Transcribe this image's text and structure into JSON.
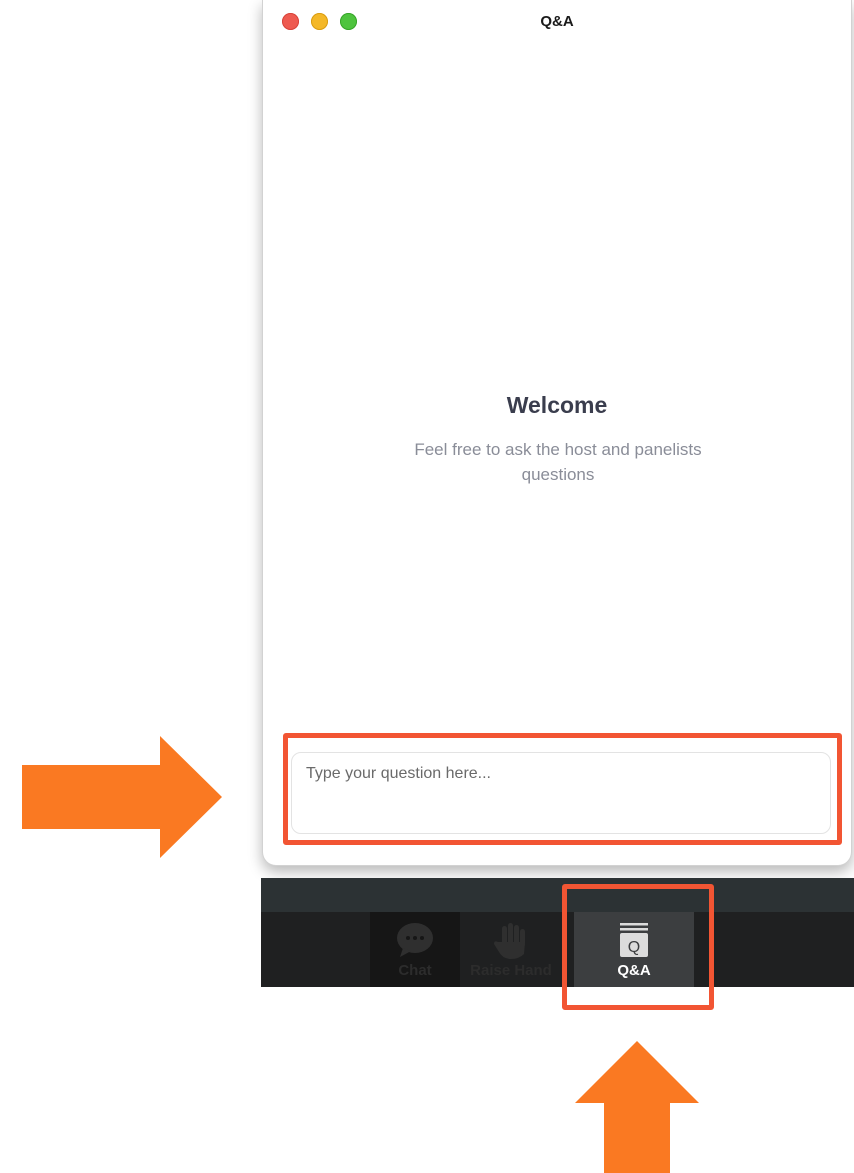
{
  "window": {
    "title": "Q&A"
  },
  "welcome": {
    "title": "Welcome",
    "text": "Feel free to ask the host and panelists questions"
  },
  "question_input": {
    "placeholder": "Type your question here...",
    "value": ""
  },
  "toolbar": {
    "items": [
      {
        "label": "Chat",
        "icon": "chat-bubble-icon"
      },
      {
        "label": "Raise Hand",
        "icon": "hand-icon"
      },
      {
        "label": "Q&A",
        "icon": "qa-icon",
        "active": true
      }
    ]
  },
  "annotations": {
    "highlight_color": "#f25533",
    "arrow_color": "#fa7922"
  }
}
